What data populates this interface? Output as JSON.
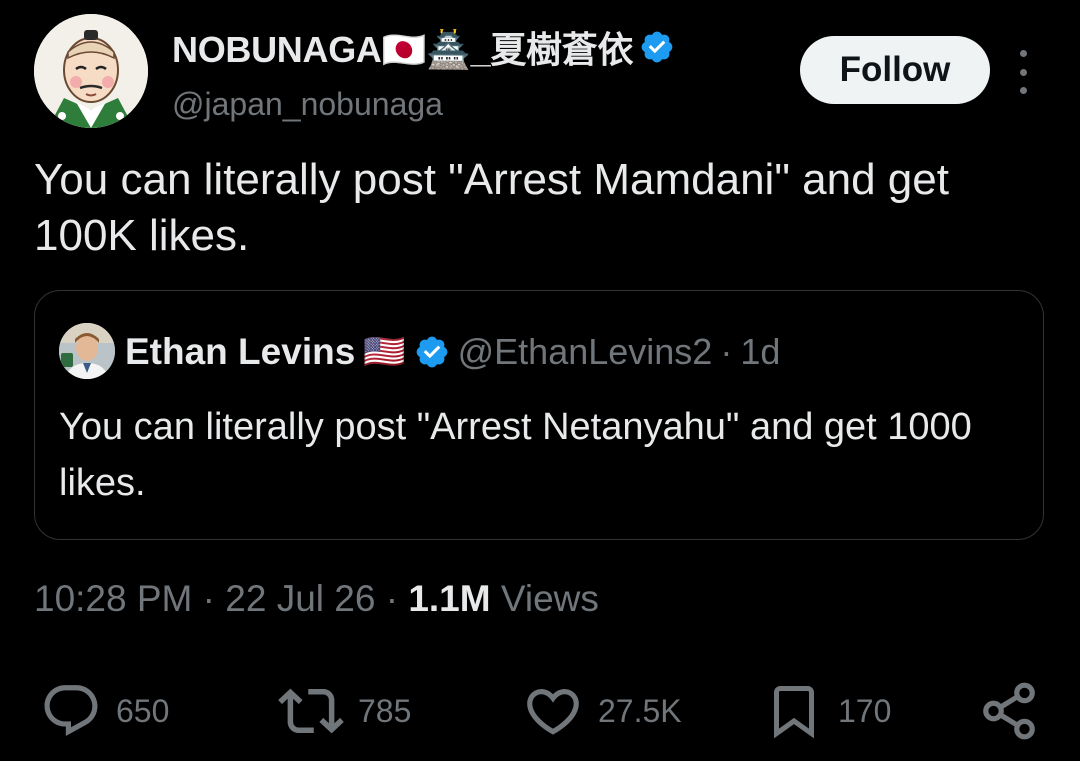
{
  "author": {
    "display_name": "NOBUNAGA🇯🇵🏯_夏樹蒼依",
    "handle": "@japan_nobunaga",
    "verified": true
  },
  "follow_button": {
    "label": "Follow"
  },
  "tweet": {
    "text": "You can literally post \"Arrest Mamdani\" and get 100K likes."
  },
  "quoted": {
    "display_name": "Ethan Levins",
    "flag": "🇺🇸",
    "handle": "@EthanLevins2",
    "separator": "·",
    "age": "1d",
    "text": "You can literally post \"Arrest Netanyahu\" and get 1000 likes."
  },
  "meta": {
    "time": "10:28 PM",
    "date": "22 Jul 26",
    "views_count": "1.1M",
    "views_label": "Views",
    "separator": "·"
  },
  "actions": {
    "replies": "650",
    "reposts": "785",
    "likes": "27.5K",
    "bookmarks": "170"
  },
  "colors": {
    "background": "#000000",
    "text_primary": "#e7e9ea",
    "text_secondary": "#71767b",
    "verified_blue": "#1d9bf0",
    "border": "#2f3336",
    "follow_bg": "#eff3f4"
  },
  "icons": {
    "verified": "verified-badge-icon",
    "more": "more-options-icon",
    "reply": "reply-icon",
    "repost": "repost-icon",
    "like": "heart-icon",
    "bookmark": "bookmark-icon",
    "share": "share-icon"
  }
}
